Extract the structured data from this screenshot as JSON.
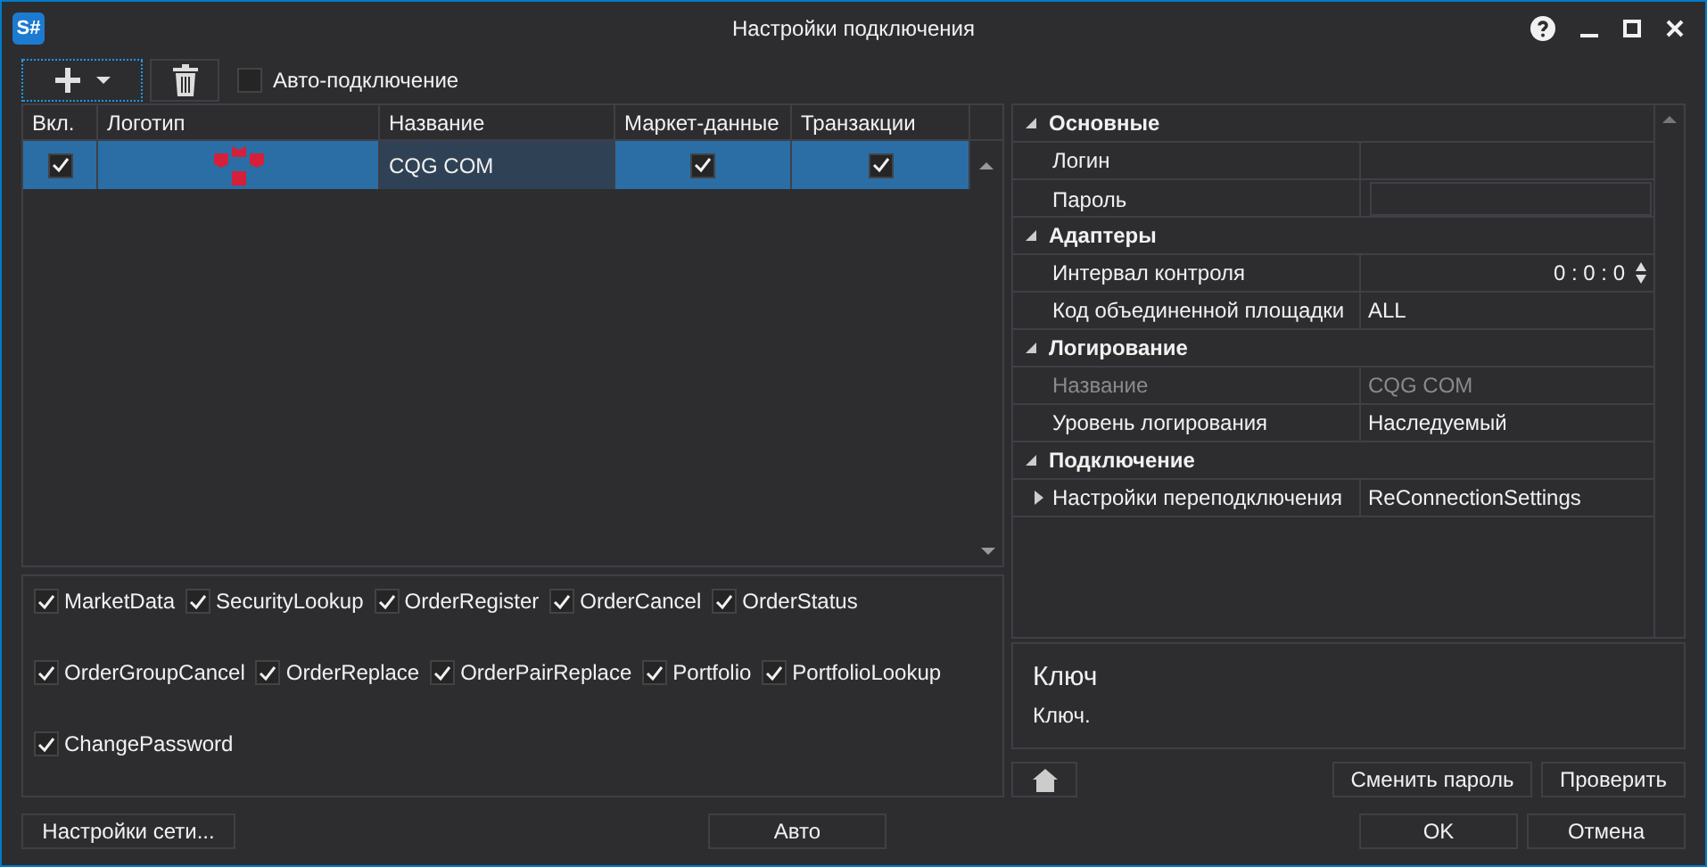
{
  "window": {
    "title": "Настройки подключения",
    "logo": "S#"
  },
  "toolbar": {
    "auto_connect": {
      "label": "Авто-подключение",
      "checked": false
    }
  },
  "connections": {
    "columns": [
      "Вкл.",
      "Логотип",
      "Название",
      "Маркет-данные",
      "Транзакции"
    ],
    "rows": [
      {
        "enabled": true,
        "name": "CQG COM",
        "market_data": true,
        "transactions": true,
        "selected": true
      }
    ]
  },
  "capabilities": [
    {
      "label": "MarketData",
      "checked": true
    },
    {
      "label": "SecurityLookup",
      "checked": true
    },
    {
      "label": "OrderRegister",
      "checked": true
    },
    {
      "label": "OrderCancel",
      "checked": true
    },
    {
      "label": "OrderStatus",
      "checked": true
    },
    {
      "label": "OrderGroupCancel",
      "checked": true
    },
    {
      "label": "OrderReplace",
      "checked": true
    },
    {
      "label": "OrderPairReplace",
      "checked": true
    },
    {
      "label": "Portfolio",
      "checked": true
    },
    {
      "label": "PortfolioLookup",
      "checked": true
    },
    {
      "label": "ChangePassword",
      "checked": true
    }
  ],
  "properties": [
    {
      "kind": "category",
      "label": "Основные",
      "expanded": true
    },
    {
      "kind": "text",
      "label": "Логин",
      "disabled": false
    },
    {
      "kind": "password",
      "label": "Пароль",
      "disabled": false
    },
    {
      "kind": "category",
      "label": "Адаптеры",
      "expanded": true
    },
    {
      "kind": "spinner",
      "label": "Интервал контроля",
      "value": "0 : 0 : 0",
      "disabled": false
    },
    {
      "kind": "text",
      "label": "Код объединенной площадки",
      "value": "ALL",
      "disabled": false
    },
    {
      "kind": "category",
      "label": "Логирование",
      "expanded": true
    },
    {
      "kind": "text",
      "label": "Название",
      "value": "CQG COM",
      "disabled": true
    },
    {
      "kind": "text",
      "label": "Уровень логирования",
      "value": "Наследуемый",
      "disabled": false
    },
    {
      "kind": "category",
      "label": "Подключение",
      "expanded": true
    },
    {
      "kind": "expandable",
      "label": "Настройки переподключения",
      "value": "ReConnectionSettings",
      "expanded": false,
      "disabled": false
    }
  ],
  "description": {
    "title": "Ключ",
    "text": "Ключ."
  },
  "property_buttons": [
    "Сменить пароль",
    "Проверить"
  ],
  "footer": {
    "network": "Настройки сети...",
    "auto": "Авто",
    "ok": "OK",
    "cancel": "Отмена"
  }
}
